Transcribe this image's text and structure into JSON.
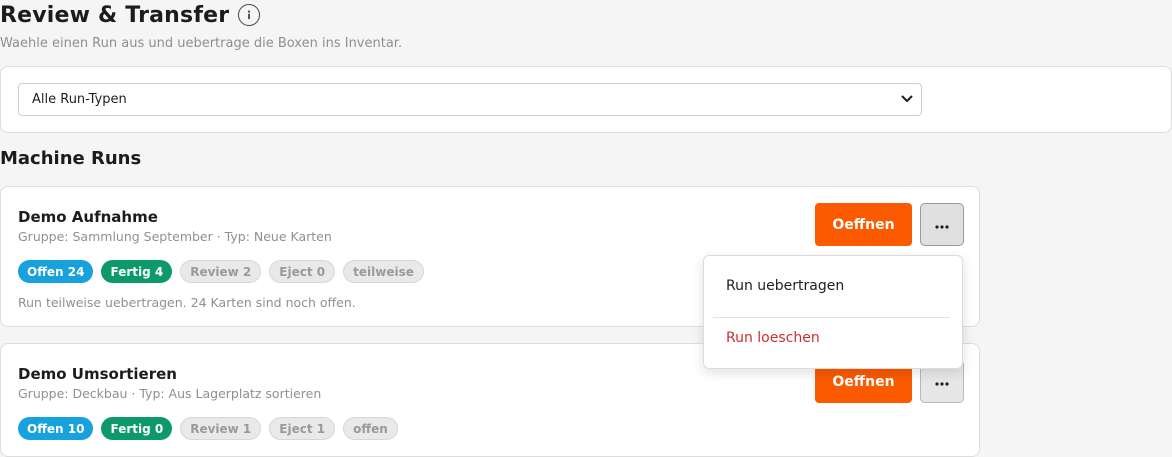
{
  "header": {
    "title": "Review & Transfer",
    "subtitle": "Waehle einen Run aus und uebertrage die Boxen ins Inventar."
  },
  "filter": {
    "selected": "Alle Run-Typen"
  },
  "section": {
    "title": "Machine Runs"
  },
  "runs": [
    {
      "name": "Demo Aufnahme",
      "meta": "Gruppe: Sammlung September · Typ: Neue Karten",
      "badges": {
        "offen": "Offen 24",
        "fertig": "Fertig 4",
        "review": "Review 2",
        "eject": "Eject 0",
        "status": "teilweise"
      },
      "note": "Run teilweise uebertragen. 24 Karten sind noch offen.",
      "open_label": "Oeffnen"
    },
    {
      "name": "Demo Umsortieren",
      "meta": "Gruppe: Deckbau · Typ: Aus Lagerplatz sortieren",
      "badges": {
        "offen": "Offen 10",
        "fertig": "Fertig 0",
        "review": "Review 1",
        "eject": "Eject 1",
        "status": "offen"
      },
      "open_label": "Oeffnen"
    }
  ],
  "menu": {
    "transfer_label": "Run uebertragen",
    "delete_label": "Run loeschen"
  },
  "icons": {
    "info": "info-icon",
    "more": "more-horizontal-icon",
    "dropdown": "chevron-down-icon"
  },
  "colors": {
    "accent": "#fb5a00",
    "offen": "#17a2dd",
    "fertig": "#0d9a68",
    "danger": "#cc2f2f"
  }
}
